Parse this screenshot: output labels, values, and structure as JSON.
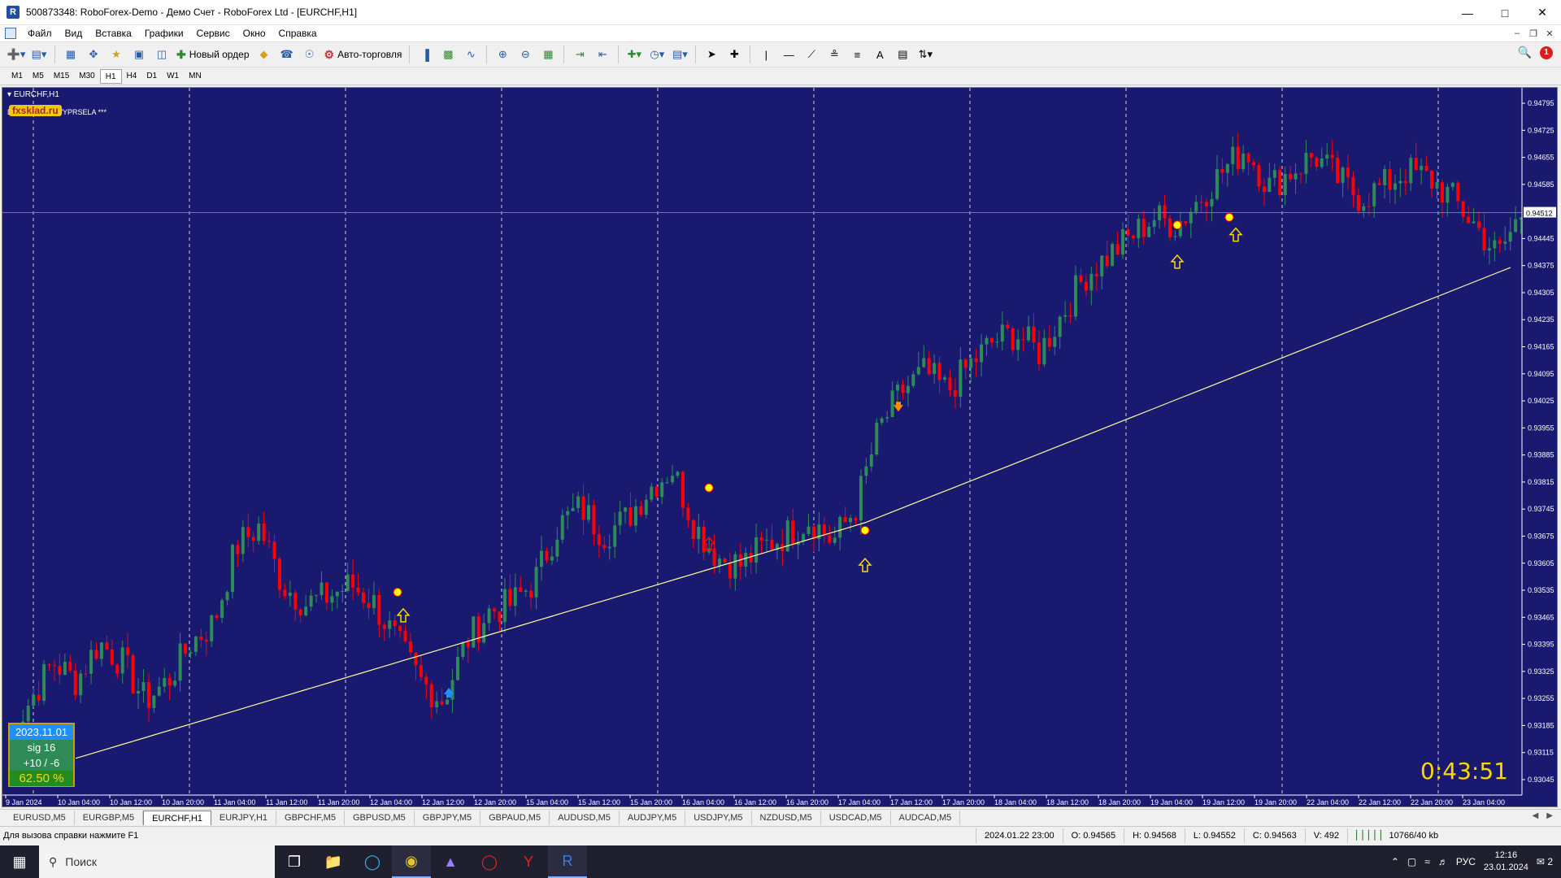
{
  "window": {
    "title": "500873348: RoboForex-Demo - Демо Счет - RoboForex Ltd - [EURCHF,H1]",
    "app_icon": "R"
  },
  "menu": [
    "Файл",
    "Вид",
    "Вставка",
    "Графики",
    "Сервис",
    "Окно",
    "Справка"
  ],
  "toolbar": {
    "new_order": "Новый ордер",
    "auto_trading": "Авто-торговля",
    "notification_count": "1"
  },
  "timeframes": [
    "M1",
    "M5",
    "M15",
    "M30",
    "H1",
    "H4",
    "D1",
    "W1",
    "MN"
  ],
  "active_timeframe": "H1",
  "chart": {
    "symbol_label": "EURCHF,H1",
    "indicator_label": "DIVERGENCE VYPRSELA ***",
    "watermark": "fxsklad.ru",
    "countdown": "0:43:51",
    "current_price": "0.94512",
    "colors": {
      "background": "#191970",
      "bull": "#2e8b57",
      "bear": "#ff0000",
      "ma": "#ffff99",
      "grid": "#ffffff",
      "arrow_up": "#ffd700",
      "arrow_down": "#ff0000"
    },
    "info_box": {
      "date": "2023.11.01",
      "sig": "sig 16",
      "pips": "+10 / -6",
      "percent": "62.50 %"
    }
  },
  "chart_data": {
    "type": "candlestick",
    "price_axis": [
      "0.94795",
      "0.94725",
      "0.94655",
      "0.94585",
      "0.94512",
      "0.94445",
      "0.94375",
      "0.94305",
      "0.94235",
      "0.94165",
      "0.94095",
      "0.94025",
      "0.93955",
      "0.93885",
      "0.93815",
      "0.93745",
      "0.93675",
      "0.93605",
      "0.93535",
      "0.93465",
      "0.93395",
      "0.93325",
      "0.93255",
      "0.93185",
      "0.93115",
      "0.93045"
    ],
    "time_axis": [
      "9 Jan 2024",
      "10 Jan 04:00",
      "10 Jan 12:00",
      "10 Jan 20:00",
      "11 Jan 04:00",
      "11 Jan 12:00",
      "11 Jan 20:00",
      "12 Jan 04:00",
      "12 Jan 12:00",
      "12 Jan 20:00",
      "15 Jan 04:00",
      "15 Jan 12:00",
      "15 Jan 20:00",
      "16 Jan 04:00",
      "16 Jan 12:00",
      "16 Jan 20:00",
      "17 Jan 04:00",
      "17 Jan 12:00",
      "17 Jan 20:00",
      "18 Jan 04:00",
      "18 Jan 12:00",
      "18 Jan 20:00",
      "19 Jan 04:00",
      "19 Jan 12:00",
      "19 Jan 20:00",
      "22 Jan 04:00",
      "22 Jan 12:00",
      "22 Jan 20:00",
      "23 Jan 04:00"
    ],
    "close_path": [
      0.9315,
      0.9325,
      0.9335,
      0.933,
      0.934,
      0.9335,
      0.9325,
      0.933,
      0.934,
      0.9345,
      0.9365,
      0.937,
      0.9355,
      0.935,
      0.9352,
      0.9355,
      0.935,
      0.934,
      0.933,
      0.9325,
      0.934,
      0.9348,
      0.935,
      0.9356,
      0.937,
      0.9375,
      0.9368,
      0.9372,
      0.938,
      0.9385,
      0.937,
      0.9362,
      0.936,
      0.9365,
      0.9368,
      0.9372,
      0.9366,
      0.9375,
      0.9395,
      0.9405,
      0.941,
      0.9405,
      0.9412,
      0.9418,
      0.942,
      0.9415,
      0.9425,
      0.9435,
      0.944,
      0.9445,
      0.945,
      0.9448,
      0.9455,
      0.9462,
      0.9468,
      0.9458,
      0.9462,
      0.9466,
      0.946,
      0.9455,
      0.9458,
      0.9462,
      0.946,
      0.9455,
      0.9448,
      0.944,
      0.9451
    ],
    "ma_range": [
      0.931,
      0.9437
    ]
  },
  "symbol_tabs": [
    "EURUSD,M5",
    "EURGBP,M5",
    "EURCHF,H1",
    "EURJPY,H1",
    "GBPCHF,M5",
    "GBPUSD,M5",
    "GBPJPY,M5",
    "GBPAUD,M5",
    "AUDUSD,M5",
    "AUDJPY,M5",
    "USDJPY,M5",
    "NZDUSD,M5",
    "USDCAD,M5",
    "AUDCAD,M5"
  ],
  "active_symbol_tab": "EURCHF,H1",
  "status": {
    "help": "Для вызова справки нажмите F1",
    "datetime": "2024.01.22 23:00",
    "open": "O: 0.94565",
    "high": "H: 0.94568",
    "low": "L: 0.94552",
    "close": "C: 0.94563",
    "volume": "V: 492",
    "traffic": "10766/40 kb"
  },
  "taskbar": {
    "search_placeholder": "Поиск",
    "lang": "РУС",
    "time": "12:16",
    "date": "23.01.2024",
    "notifications": "2"
  }
}
